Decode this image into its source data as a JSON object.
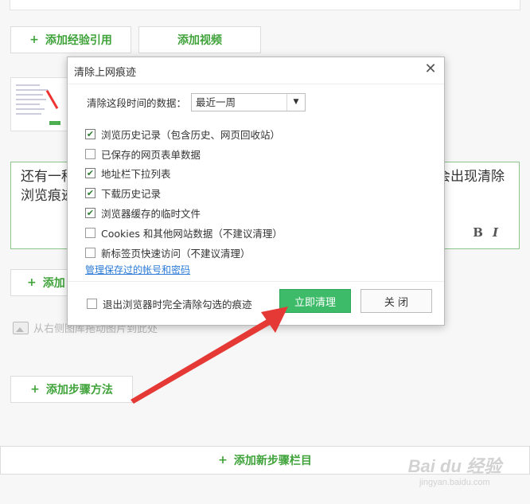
{
  "editor": {
    "add_experience_ref": "添加经验引用",
    "add_video": "添加视频",
    "text_left": "还有一种",
    "text_left_line2": "浏览痕迹",
    "text_right": "会出现清除",
    "bold": "B",
    "italic": "I",
    "add_partial": "添加",
    "drag_hint": "从右侧图库拖动图片到此处",
    "add_step_method": "添加步骤方法",
    "add_new_step_section": "添加新步骤栏目",
    "plus": "+"
  },
  "watermark": {
    "main": "Bai du 经验",
    "sub": "jingyan.baidu.com"
  },
  "dialog": {
    "title": "清除上网痕迹",
    "close_symbol": "✕",
    "range_label": "清除这段时间的数据：",
    "range_value": "最近一周",
    "options": [
      {
        "label": "浏览历史记录（包含历史、网页回收站）",
        "checked": true
      },
      {
        "label": "已保存的网页表单数据",
        "checked": false
      },
      {
        "label": "地址栏下拉列表",
        "checked": true
      },
      {
        "label": "下载历史记录",
        "checked": true
      },
      {
        "label": "浏览器缓存的临时文件",
        "checked": true
      },
      {
        "label": "Cookies 和其他网站数据（不建议清理）",
        "checked": false
      },
      {
        "label": "新标签页快速访问（不建议清理）",
        "checked": false
      }
    ],
    "manage_link": "管理保存过的帐号和密码",
    "exit_clear_label": "退出浏览器时完全清除勾选的痕迹",
    "exit_clear_checked": false,
    "clear_now": "立即清理",
    "close_button": "关 闭"
  },
  "colors": {
    "accent_green": "#3fa33a",
    "primary_button": "#3dbb69",
    "link_blue": "#2b7bd6",
    "arrow_red": "#e53935"
  }
}
